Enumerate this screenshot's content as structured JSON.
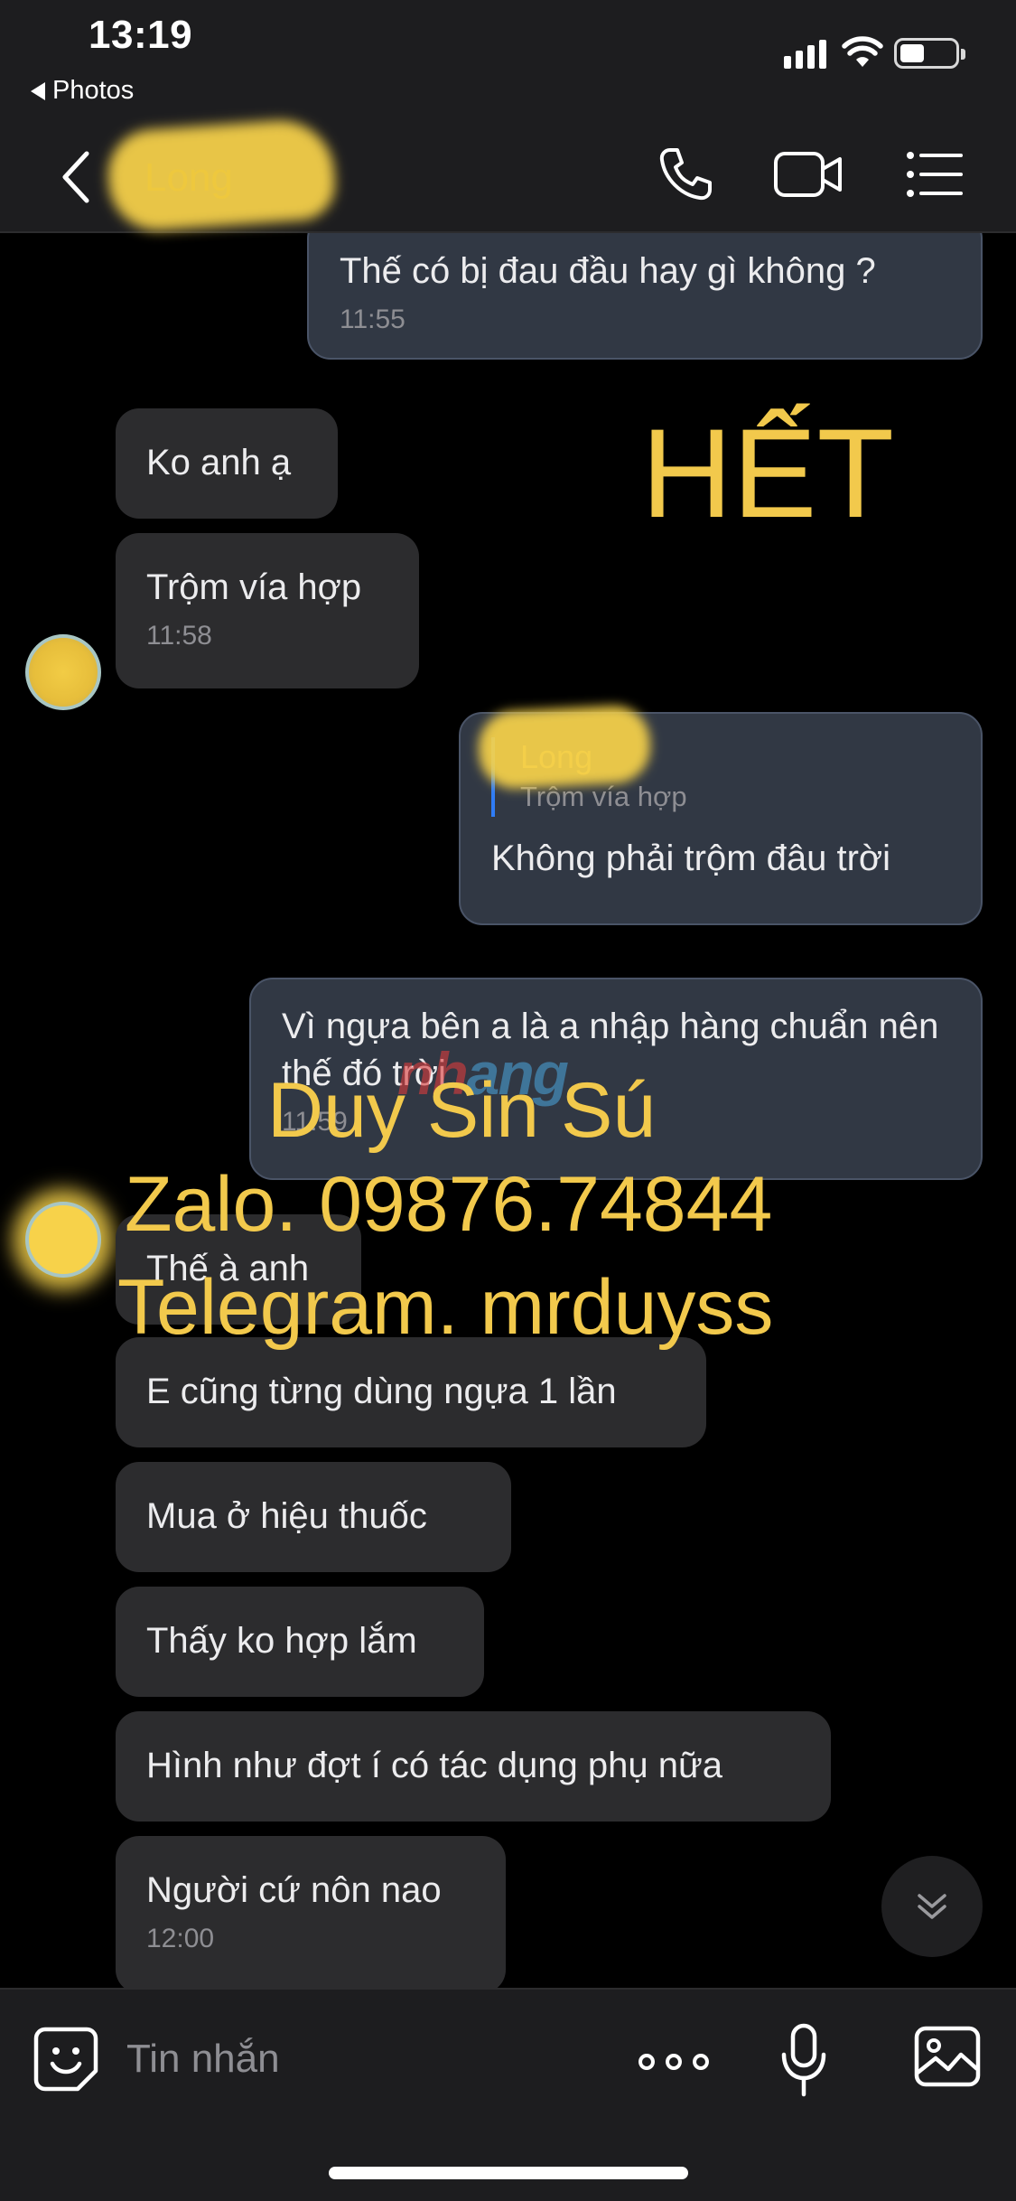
{
  "status_bar": {
    "time": "13:19",
    "back_app_label": "Photos",
    "icons": [
      "cellular-signal-icon",
      "wifi-icon",
      "battery-icon"
    ]
  },
  "header": {
    "contact_name": "Long",
    "icons": [
      "back-chevron-icon",
      "phone-icon",
      "video-camera-icon",
      "menu-list-icon"
    ]
  },
  "messages": [
    {
      "side": "sent",
      "text": "Thế có bị đau đầu hay gì không ?",
      "time": "11:55"
    },
    {
      "side": "received",
      "text": "Ko anh ạ"
    },
    {
      "side": "received",
      "text": "Trộm vía hợp",
      "time": "11:58"
    },
    {
      "side": "sent",
      "quote_name": "Long",
      "quote_text": "Trộm vía hợp",
      "text": "Không phải trộm đâu trời"
    },
    {
      "side": "sent",
      "text": "Vì ngựa bên a là a nhập hàng chuẩn nên thế đó trời",
      "time": "11:59"
    },
    {
      "side": "received",
      "text": "Thế à anh"
    },
    {
      "side": "received",
      "text": "E cũng từng dùng ngựa 1 lần"
    },
    {
      "side": "received",
      "text": "Mua ở hiệu thuốc"
    },
    {
      "side": "received",
      "text": "Thấy ko hợp lắm"
    },
    {
      "side": "received",
      "text": "Hình như đợt í có tác dụng phụ nữa"
    },
    {
      "side": "received",
      "text": "Người cứ nôn nao",
      "time": "12:00"
    }
  ],
  "watermark": {
    "het": "HẾT",
    "name": "Duy Sin Sú",
    "zalo": "Zalo. 09876.74844",
    "telegram": "Telegram. mrduyss",
    "logo_a": "nh",
    "logo_b": "ang"
  },
  "input_bar": {
    "placeholder": "Tin nhắn",
    "icons": [
      "sticker-icon",
      "more-options-icon",
      "microphone-icon",
      "image-gallery-icon"
    ]
  },
  "colors": {
    "background": "#000000",
    "bar": "#1d1d1f",
    "received_bubble": "#2c2c2e",
    "sent_bubble": "#313844",
    "watermark": "#f2c94c",
    "quote_accent": "#2f7cf6"
  }
}
